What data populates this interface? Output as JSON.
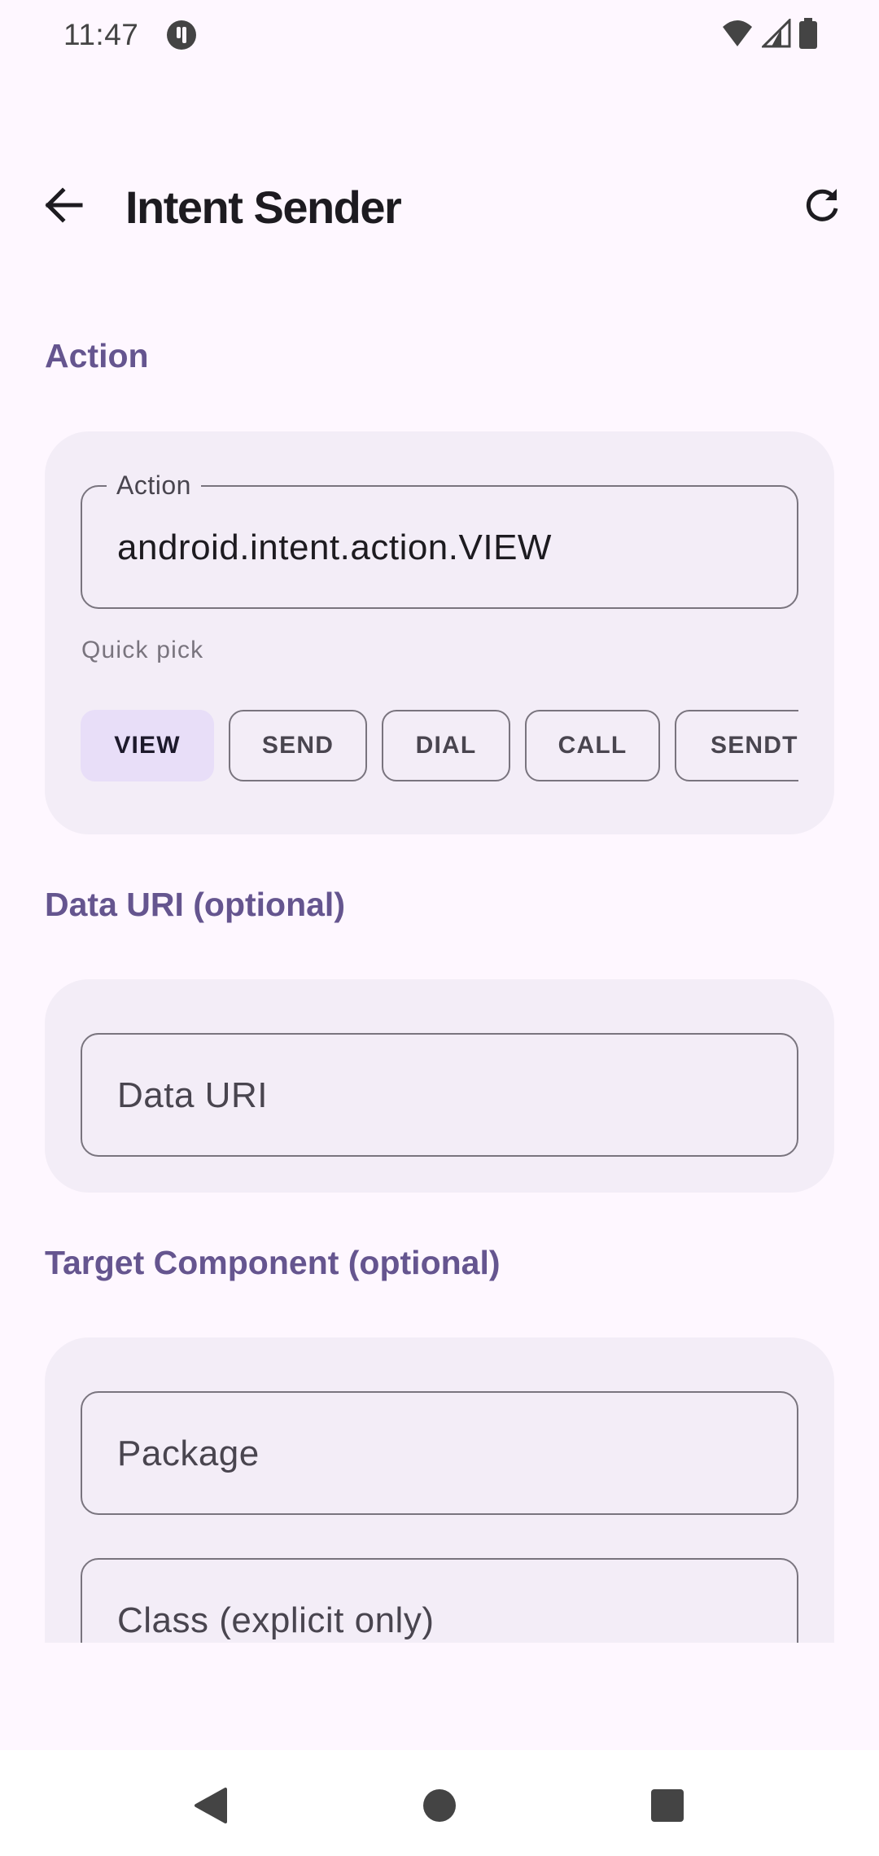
{
  "status_bar": {
    "time": "11:47",
    "icons": [
      "app-notification-icon",
      "wifi-icon",
      "signal-icon",
      "battery-icon"
    ]
  },
  "app_bar": {
    "title": "Intent Sender",
    "back_icon": "arrow-back-icon",
    "refresh_icon": "refresh-icon"
  },
  "sections": {
    "action": {
      "title": "Action",
      "field_label": "Action",
      "field_value": "android.intent.action.VIEW",
      "quick_pick_label": "Quick pick",
      "chips": [
        {
          "label": "VIEW",
          "selected": true
        },
        {
          "label": "SEND",
          "selected": false
        },
        {
          "label": "DIAL",
          "selected": false
        },
        {
          "label": "CALL",
          "selected": false
        },
        {
          "label": "SENDTO",
          "selected": false
        }
      ]
    },
    "data_uri": {
      "title": "Data URI (optional)",
      "placeholder": "Data URI"
    },
    "target_component": {
      "title": "Target Component (optional)",
      "package_placeholder": "Package",
      "class_placeholder": "Class (explicit only)"
    }
  },
  "colors": {
    "background": "#FEF7FF",
    "card": "#F3EDF7",
    "accent": "#65558F",
    "chip_selected": "#E8DEF8",
    "outline": "#79747E"
  }
}
